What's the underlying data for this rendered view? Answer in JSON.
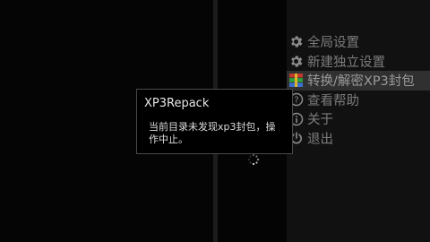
{
  "menu": {
    "items": [
      {
        "label": "全局设置",
        "icon": "gear-icon"
      },
      {
        "label": "新建独立设置",
        "icon": "gear-icon"
      },
      {
        "label": "转换/解密XP3封包",
        "icon": "archive-icon",
        "selected": true
      },
      {
        "label": "查看帮助",
        "icon": "help-icon"
      },
      {
        "label": "关于",
        "icon": "info-icon"
      },
      {
        "label": "退出",
        "icon": "power-icon"
      }
    ]
  },
  "dialog": {
    "title": "XP3Repack",
    "message": "当前目录未发现xp3封包，操作中止。"
  },
  "colors": {
    "menu_text": "#7c7c7c",
    "selected_bg": "#303030",
    "dialog_border": "#4a4a4a"
  }
}
